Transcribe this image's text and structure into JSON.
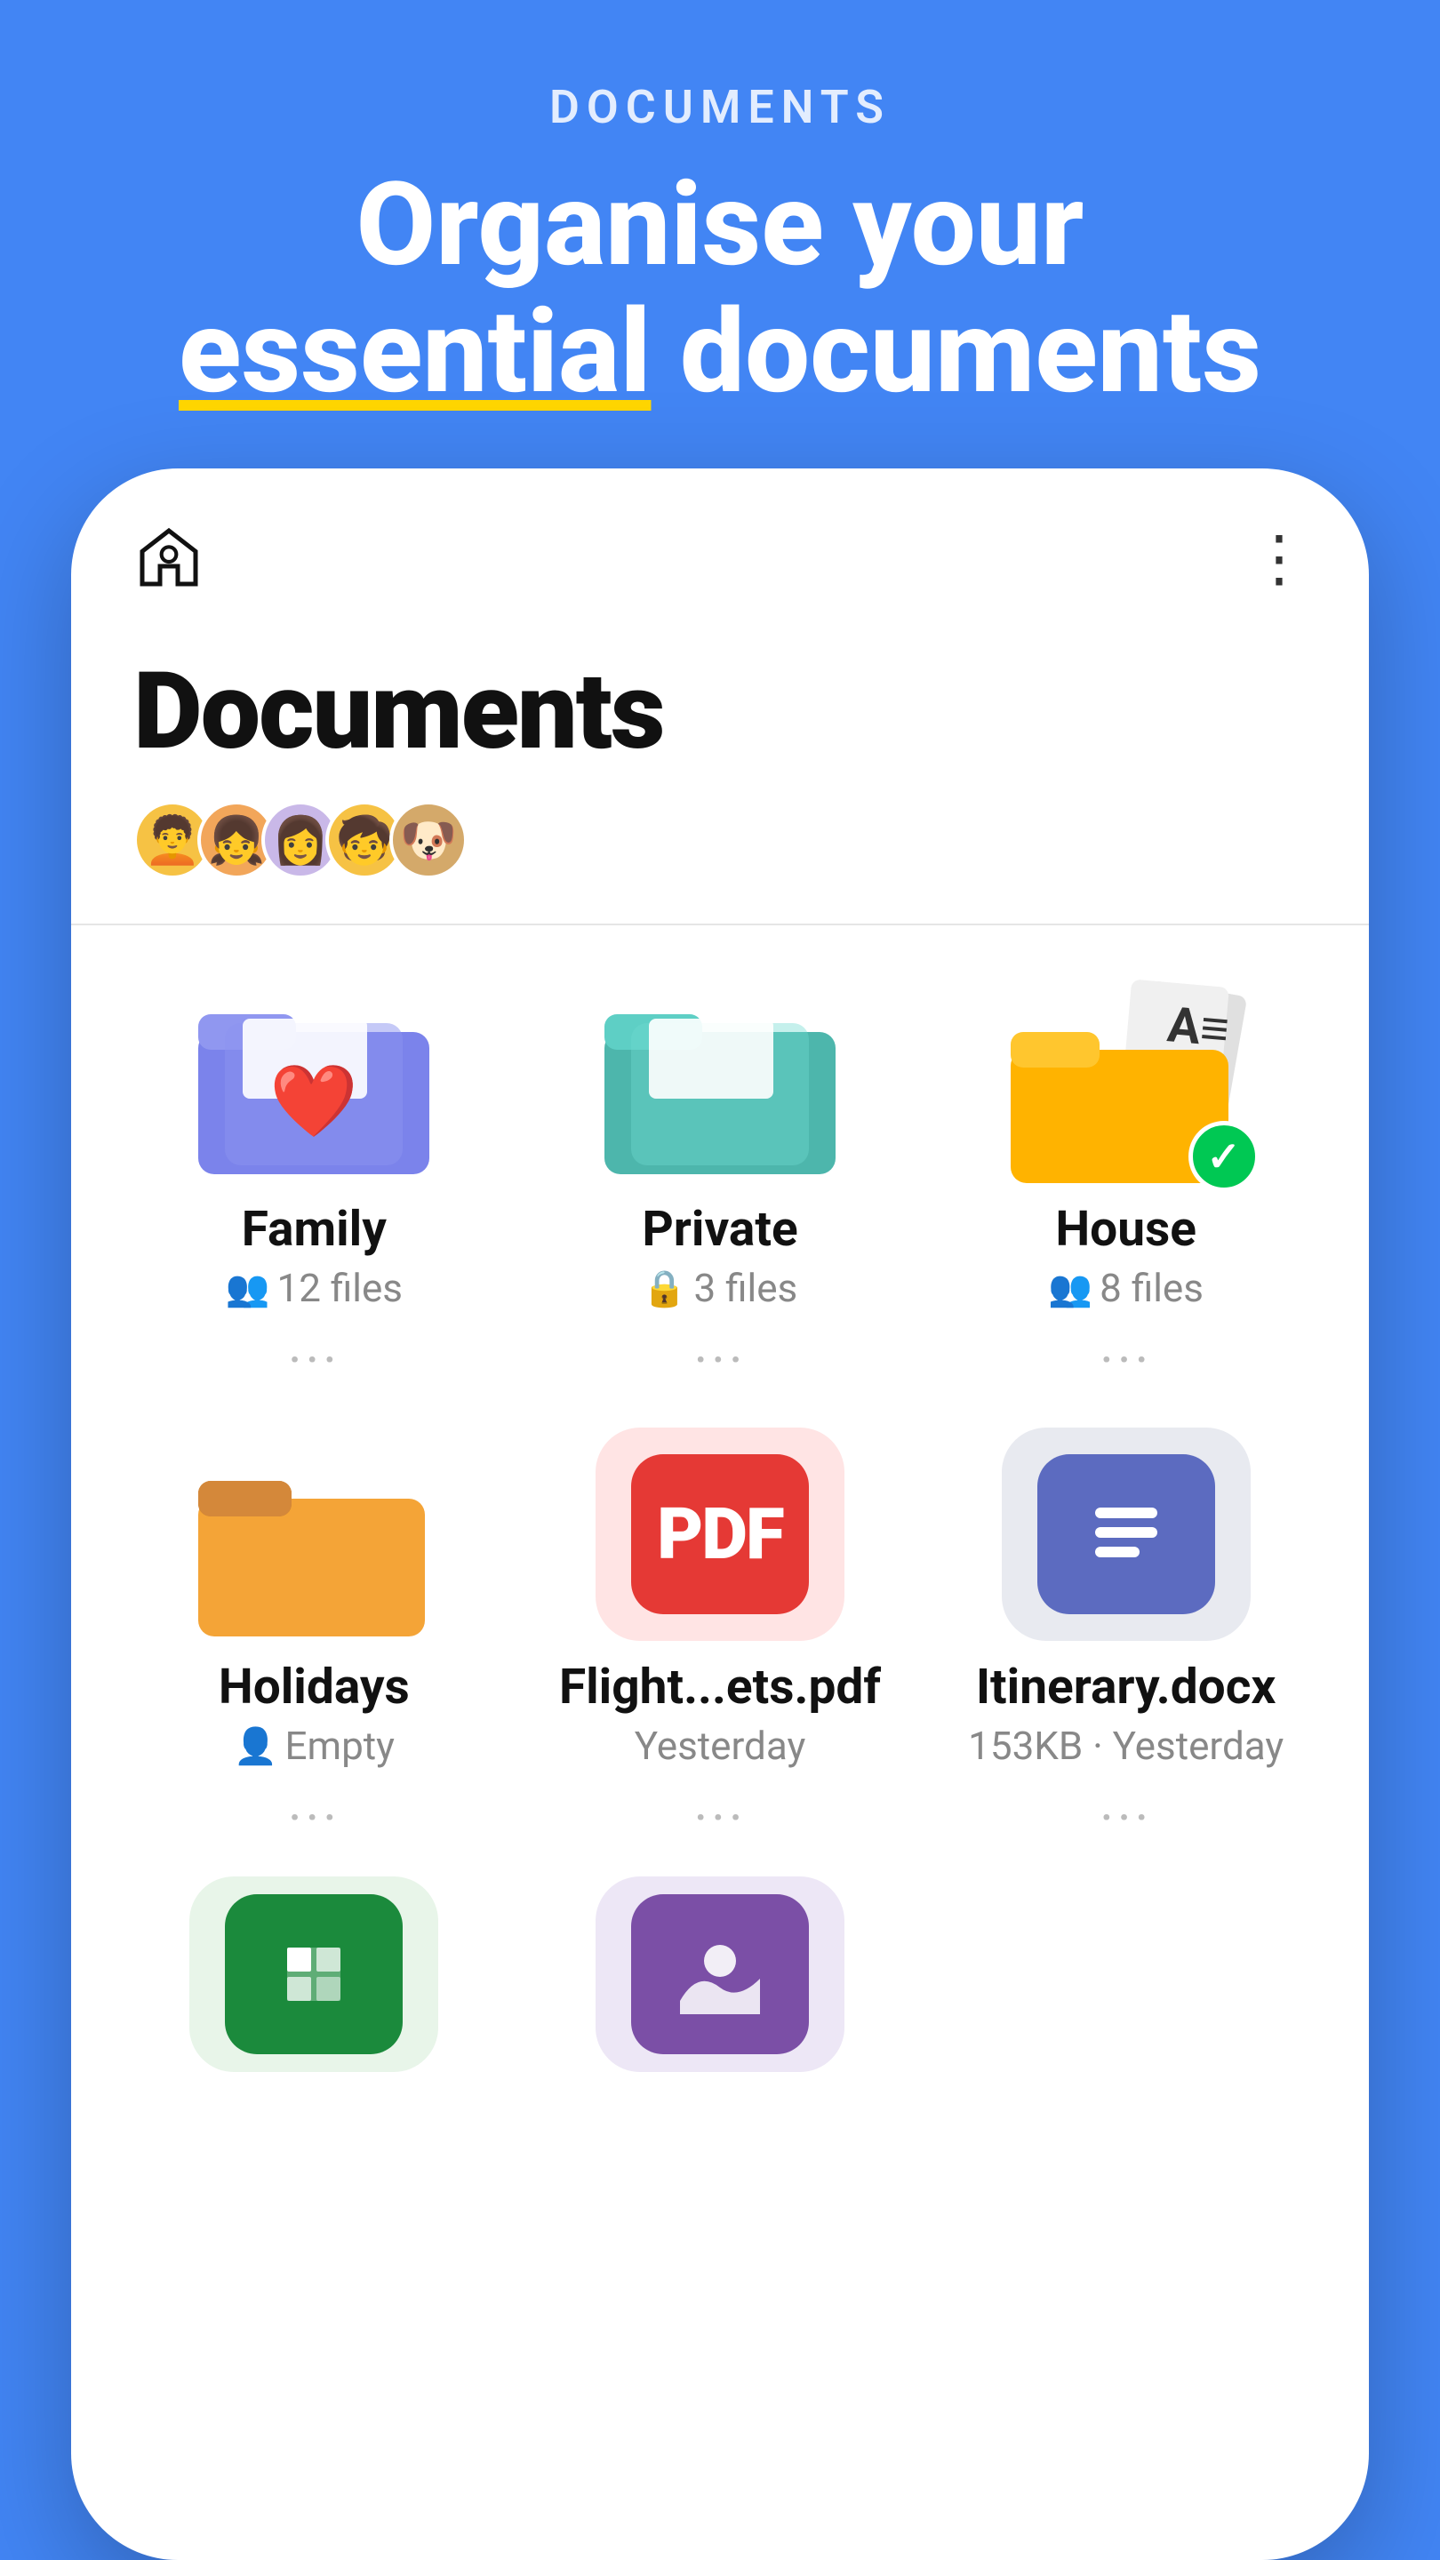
{
  "header": {
    "label": "DOCUMENTS",
    "title_line1": "Organise your",
    "title_line2_highlight": "essential",
    "title_line2_rest": " documents"
  },
  "app": {
    "page_title": "Documents",
    "avatars": [
      "🧑‍🦱",
      "👧",
      "👩",
      "🧒",
      "🐶"
    ],
    "avatar_colors": [
      "#F6C244",
      "#F2A65A",
      "#B8A4D8",
      "#F6C244",
      "#D4A96A"
    ]
  },
  "folders": [
    {
      "name": "Family",
      "meta": "12 files",
      "meta_icon": "people",
      "color": "family",
      "type": "folder"
    },
    {
      "name": "Private",
      "meta": "3 files",
      "meta_icon": "lock",
      "color": "private",
      "type": "folder"
    },
    {
      "name": "House",
      "meta": "8 files",
      "meta_icon": "people",
      "color": "house",
      "type": "folder",
      "badge": "check"
    },
    {
      "name": "Holidays",
      "meta": "Empty",
      "meta_icon": "people",
      "color": "holidays",
      "type": "folder"
    },
    {
      "name": "Flight...ets.pdf",
      "meta": "Yesterday",
      "meta_icon": null,
      "color": "pdf",
      "type": "file"
    },
    {
      "name": "Itinerary.docx",
      "meta": "153KB · Yesterday",
      "meta_icon": null,
      "color": "docx",
      "type": "file"
    }
  ],
  "bottom_items": [
    {
      "name": "sheets",
      "color": "sheets"
    },
    {
      "name": "photos",
      "color": "photos"
    }
  ],
  "icons": {
    "home": "⌂",
    "more": "⋮"
  }
}
